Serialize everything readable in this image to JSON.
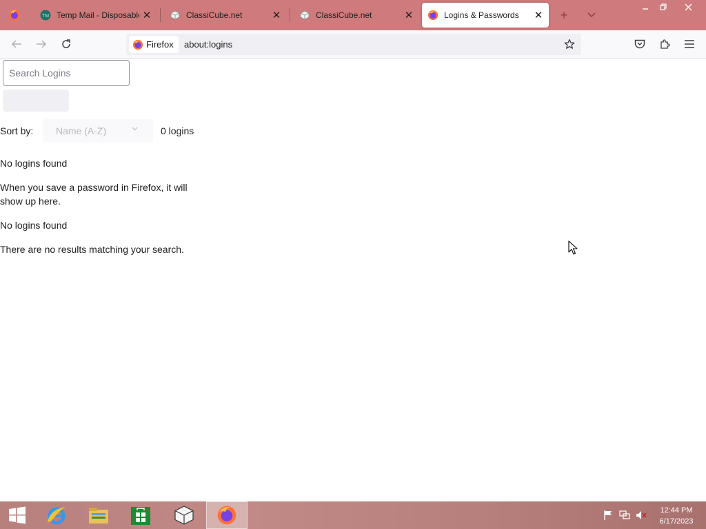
{
  "tabs": [
    {
      "title": "Temp Mail - Disposable",
      "favicon": "tempmail-icon",
      "selected": false
    },
    {
      "title": "ClassiCube.net",
      "favicon": "classicube-icon",
      "selected": false
    },
    {
      "title": "ClassiCube.net",
      "favicon": "classicube-icon",
      "selected": false
    },
    {
      "title": "Logins & Passwords",
      "favicon": "firefox-icon",
      "selected": true
    }
  ],
  "navbar": {
    "identity_label": "Firefox",
    "url": "about:logins"
  },
  "logins": {
    "search_placeholder": "Search Logins",
    "sort_label": "Sort by:",
    "sort_value": "Name (A-Z)",
    "count_label": "0 logins",
    "empty_title": "No logins found",
    "empty_description": "When you save a password in Firefox, it will show up here.",
    "no_match_title": "No logins found",
    "no_match_description": "There are no results matching your search."
  },
  "taskbar": {
    "apps": [
      "start-icon",
      "internet-explorer-icon",
      "file-explorer-icon",
      "store-icon",
      "classicube-icon",
      "firefox-icon"
    ],
    "clock_time": "12:44 PM",
    "clock_date": "6/17/2023"
  },
  "colors": {
    "tabstrip": "#cf7a7c",
    "accent_text": "#1e1e1e"
  }
}
